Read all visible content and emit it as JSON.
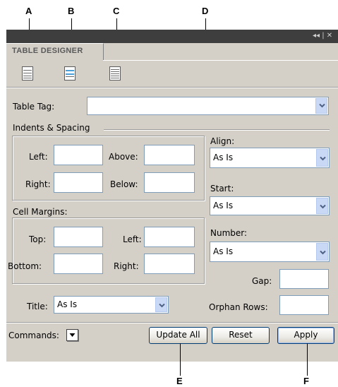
{
  "callouts": {
    "a": "A",
    "b": "B",
    "c": "C",
    "d": "D",
    "e": "E",
    "f": "F"
  },
  "panel": {
    "titlebar_controls": "◂◂ | ✕",
    "tab_label": "TABLE DESIGNER",
    "toolbar_icons": [
      "table-icon",
      "table-highlight-icon",
      "table-striped-icon"
    ]
  },
  "table_tag": {
    "label": "Table Tag:",
    "value": ""
  },
  "indents": {
    "group_label": "Indents & Spacing",
    "left_label": "Left:",
    "left_value": "",
    "above_label": "Above:",
    "above_value": "",
    "right_label": "Right:",
    "right_value": "",
    "below_label": "Below:",
    "below_value": ""
  },
  "cell_margins": {
    "group_label": "Cell Margins:",
    "top_label": "Top:",
    "top_value": "",
    "left_label": "Left:",
    "left_value": "",
    "bottom_label": "Bottom:",
    "bottom_value": "",
    "right_label": "Right:",
    "right_value": ""
  },
  "align": {
    "label": "Align:",
    "value": "As Is"
  },
  "start": {
    "label": "Start:",
    "value": "As Is"
  },
  "number": {
    "label": "Number:",
    "value": "As Is"
  },
  "gap": {
    "label": "Gap:",
    "value": ""
  },
  "orphan_rows": {
    "label": "Orphan Rows:",
    "value": ""
  },
  "title": {
    "label": "Title:",
    "value": "As Is"
  },
  "commands": {
    "label": "Commands:"
  },
  "buttons": {
    "update_all": "Update All",
    "reset": "Reset",
    "apply": "Apply"
  },
  "colors": {
    "titlebar": "#3e3e3e",
    "panel": "#d4d0c8",
    "dropdown_button": "#c9d8f5",
    "field_border": "#7f9db9"
  }
}
